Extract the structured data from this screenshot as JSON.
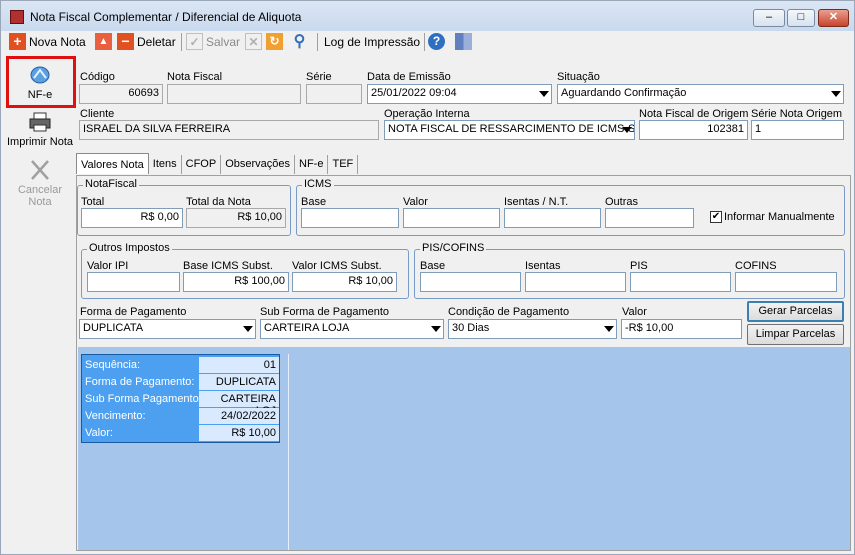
{
  "window": {
    "title": "Nota Fiscal Complementar / Diferencial de Aliquota"
  },
  "toolbar": {
    "nova_nota": "Nova Nota",
    "deletar": "Deletar",
    "salvar": "Salvar",
    "log_impressao": "Log de Impressão"
  },
  "leftbar": {
    "nfe": "NF-e",
    "imprimir": "Imprimir Nota",
    "cancelar_line1": "Cancelar",
    "cancelar_line2": "Nota"
  },
  "header": {
    "codigo_label": "Código",
    "codigo": "60693",
    "nota_fiscal_label": "Nota Fiscal",
    "nota_fiscal": "",
    "serie_label": "Série",
    "serie": "",
    "data_emissao_label": "Data de Emissão",
    "data_emissao": "25/01/2022 09:04",
    "situacao_label": "Situação",
    "situacao": "Aguardando Confirmação",
    "cliente_label": "Cliente",
    "cliente": "ISRAEL DA SILVA FERREIRA",
    "operacao_label": "Operação Interna",
    "operacao": "NOTA FISCAL DE RESSARCIMENTO DE ICMS-ST",
    "nf_origem_label": "Nota Fiscal de Origem",
    "nf_origem": "102381",
    "serie_origem_label": "Série Nota Origem",
    "serie_origem": "1"
  },
  "tabs": [
    "Valores Nota",
    "Itens",
    "CFOP",
    "Observações",
    "NF-e",
    "TEF"
  ],
  "notafiscal": {
    "title": "NotaFiscal",
    "total_label": "Total",
    "total": "R$ 0,00",
    "total_nota_label": "Total da Nota",
    "total_nota": "R$ 10,00"
  },
  "icms": {
    "title": "ICMS",
    "base_label": "Base",
    "valor_label": "Valor",
    "isentas_label": "Isentas / N.T.",
    "outras_label": "Outras",
    "informar_label": "Informar Manualmente",
    "informar_check": "✔"
  },
  "outros": {
    "title": "Outros Impostos",
    "ipi_label": "Valor IPI",
    "base_subst_label": "Base ICMS Subst.",
    "base_subst": "R$ 100,00",
    "valor_subst_label": "Valor ICMS Subst.",
    "valor_subst": "R$ 10,00"
  },
  "pis": {
    "title": "PIS/COFINS",
    "base_label": "Base",
    "isentas_label": "Isentas",
    "pis_label": "PIS",
    "cofins_label": "COFINS"
  },
  "pagamento": {
    "forma_label": "Forma de Pagamento",
    "forma": "DUPLICATA",
    "sub_label": "Sub Forma de Pagamento",
    "sub": "CARTEIRA LOJA",
    "condicao_label": "Condição de Pagamento",
    "condicao": "30 Dias",
    "valor_label": "Valor",
    "valor": "-R$ 10,00",
    "gerar": "Gerar Parcelas",
    "limpar": "Limpar Parcelas"
  },
  "parcela": {
    "rows": [
      {
        "k": "Sequência:",
        "v": "01"
      },
      {
        "k": "Forma de Pagamento:",
        "v": "DUPLICATA"
      },
      {
        "k": "Sub Forma Pagamento:",
        "v": "CARTEIRA LOJ"
      },
      {
        "k": "Vencimento:",
        "v": "24/02/2022"
      },
      {
        "k": "Valor:",
        "v": "R$ 10,00"
      }
    ]
  },
  "colors": {
    "accent_blue": "#4da0f0",
    "area_blue": "#a6c5ea",
    "highlight_red": "#e01010"
  }
}
